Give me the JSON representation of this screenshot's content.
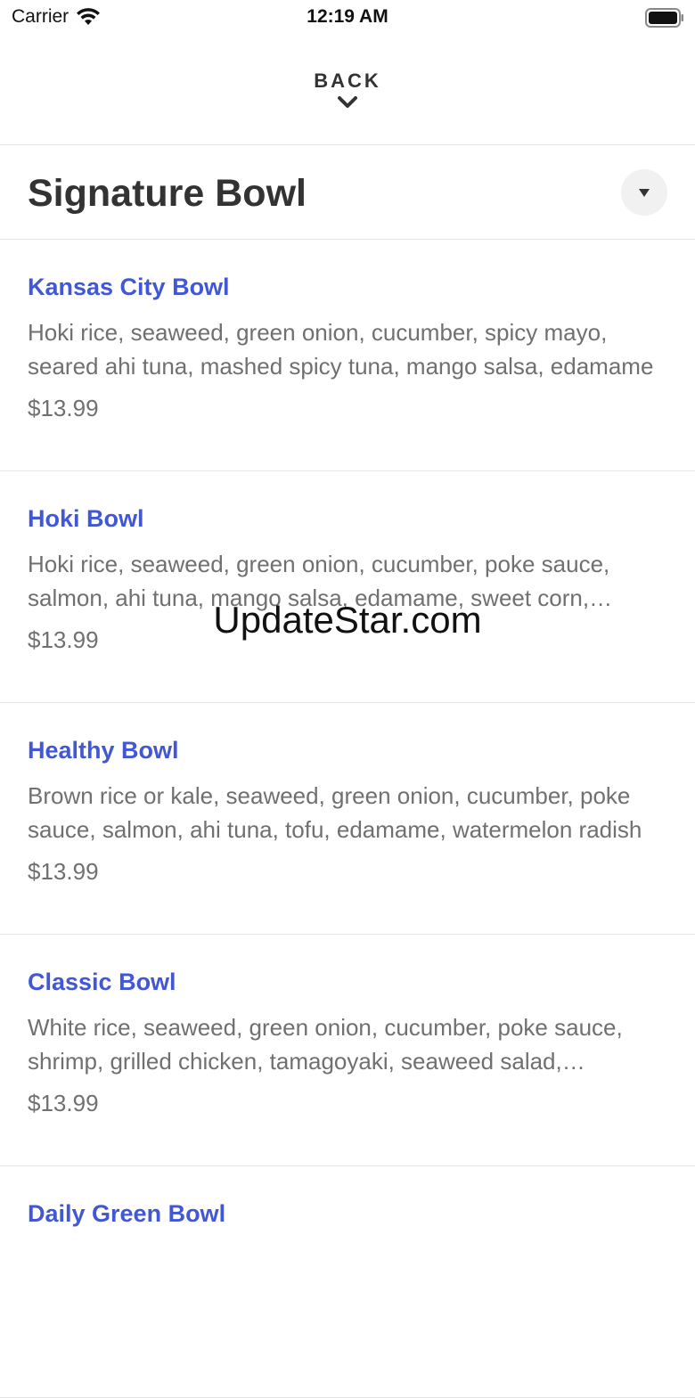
{
  "status_bar": {
    "carrier": "Carrier",
    "time": "12:19 AM",
    "wifi_icon": "wifi-icon",
    "battery_icon": "battery-icon"
  },
  "header": {
    "back_label": "BACK",
    "back_icon": "chevron-down-icon"
  },
  "section": {
    "title": "Signature Bowl",
    "dropdown_icon": "caret-down-icon"
  },
  "menu_items": [
    {
      "name": "Kansas City Bowl",
      "description": "Hoki rice, seaweed, green onion, cucumber, spicy mayo, seared ahi tuna, mashed spicy tuna, mango salsa, edamame",
      "price": "$13.99"
    },
    {
      "name": "Hoki Bowl",
      "description": "Hoki rice, seaweed, green onion, cucumber, poke sauce, salmon, ahi tuna, mango salsa, edamame, sweet corn, seaweed salad",
      "price": "$13.99"
    },
    {
      "name": "Healthy Bowl",
      "description": "Brown rice or kale, seaweed, green onion, cucumber, poke sauce, salmon, ahi tuna, tofu, edamame, watermelon radish",
      "price": "$13.99"
    },
    {
      "name": "Classic Bowl",
      "description": "White rice, seaweed, green onion, cucumber, poke sauce, shrimp, grilled chicken, tamagoyaki, seaweed salad, edamame",
      "price": "$13.99"
    },
    {
      "name": "Daily Green Bowl"
    }
  ],
  "watermark": "UpdateStar.com",
  "colors": {
    "accent": "#4257d4",
    "text": "#333333",
    "muted": "#707070",
    "divider": "#e4e4e4"
  }
}
